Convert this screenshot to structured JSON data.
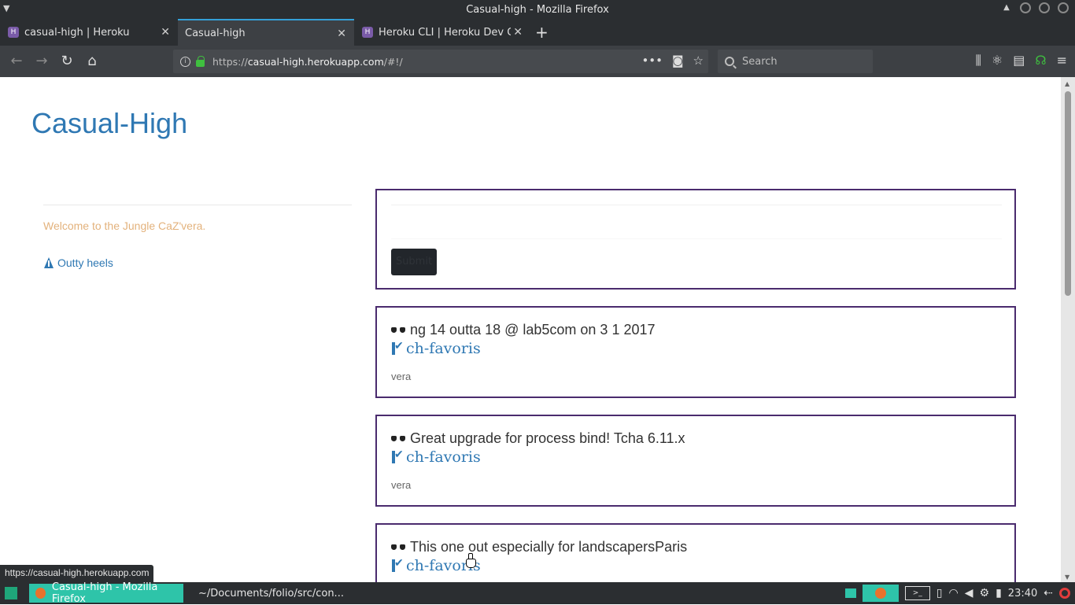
{
  "window": {
    "title": "Casual-high - Mozilla Firefox"
  },
  "tabs": [
    {
      "label": "casual-high | Heroku",
      "favicon": "heroku-icon"
    },
    {
      "label": "Casual-high",
      "active": true
    },
    {
      "label": "Heroku CLI | Heroku Dev C",
      "favicon": "heroku-icon"
    }
  ],
  "navbar": {
    "url_prefix": "https://",
    "url_domain": "casual-high.herokuapp.com",
    "url_path": "/#!/",
    "search_placeholder": "Search"
  },
  "page": {
    "site_title": "Casual-High",
    "welcome_text": "Welcome to the Jungle CaZ'vera.",
    "sidebar_link": "Outty heels",
    "compose": {
      "submit_label": "Submit"
    },
    "posts": [
      {
        "text": "ng 14 outta 18 @ lab5com on 3 1 2017",
        "link": "ch-favoris",
        "author": "vera"
      },
      {
        "text": "Great upgrade for process bind! Tcha 6.11.x",
        "link": "ch-favoris",
        "author": "vera"
      },
      {
        "text": "This one out especially for landscapersParis",
        "link": "ch-favoris",
        "author": ""
      }
    ]
  },
  "status_link": "https://casual-high.herokuapp.com",
  "taskbar": {
    "items": [
      {
        "label": "Casual-high - Mozilla Firefox",
        "active": true
      },
      {
        "label": "~/Documents/folio/src/con...",
        "active": false
      }
    ],
    "clock": "23:40"
  },
  "colors": {
    "accent_blue": "#2f78b3",
    "card_border": "#4a2b6e",
    "welcome": "#e3b27c",
    "taskbar_active": "#2ec4a9"
  }
}
